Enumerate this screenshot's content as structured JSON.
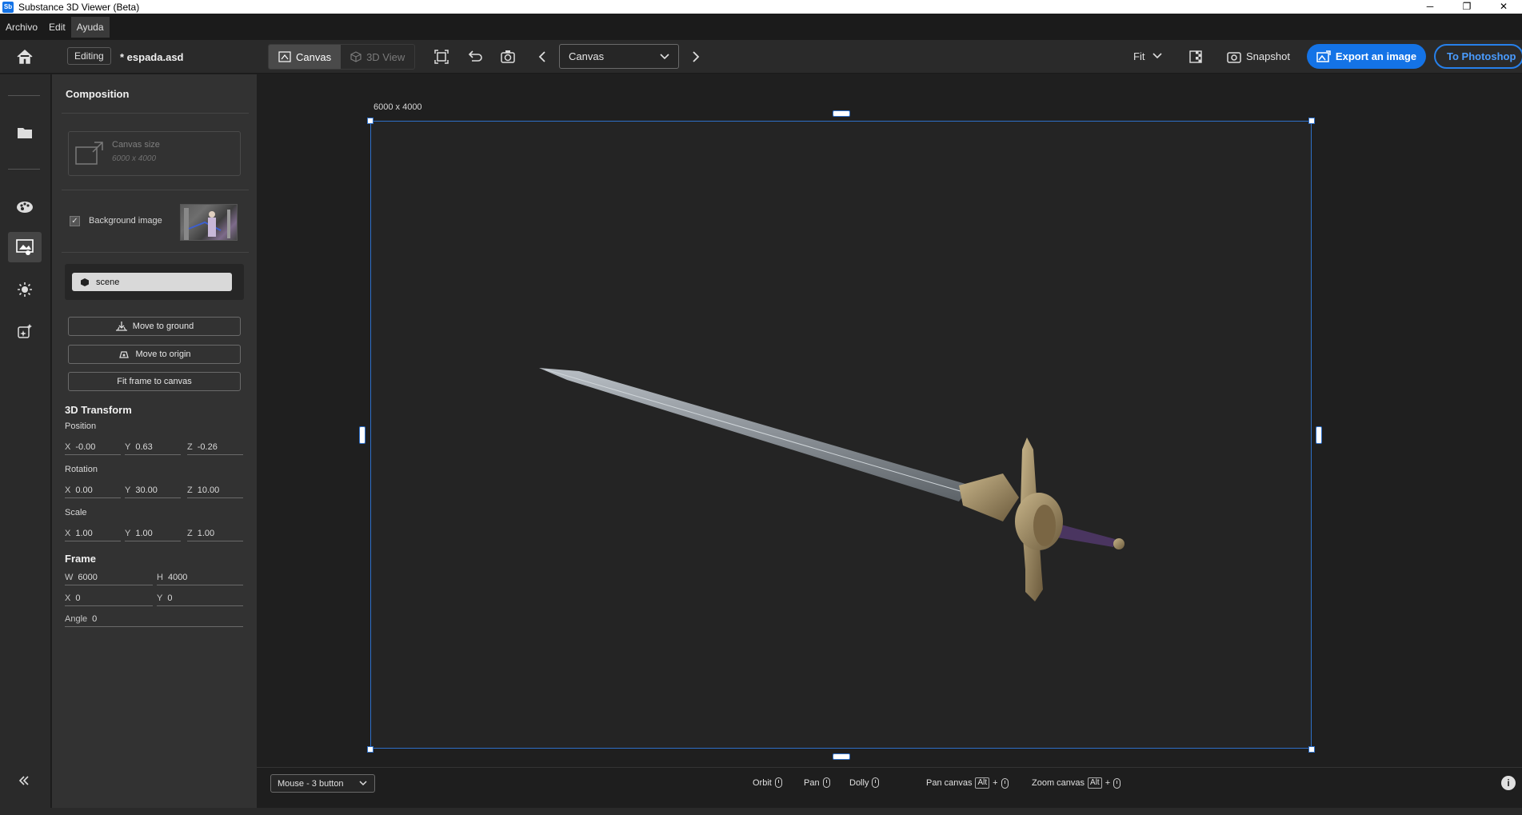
{
  "window": {
    "app_badge": "Sb",
    "title": "Substance 3D Viewer (Beta)",
    "min": "─",
    "max": "❐",
    "close": "✕"
  },
  "menu": {
    "items": [
      "Archivo",
      "Edit",
      "Ayuda"
    ]
  },
  "toolbar": {
    "editing_label": "Editing",
    "file_name": "* espada.asd",
    "canvas_tab": "Canvas",
    "view3d_tab": "3D View",
    "camera_select": "Canvas",
    "fit_label": "Fit",
    "snapshot_label": "Snapshot",
    "export_label": "Export an image",
    "photoshop_label": "To Photoshop"
  },
  "panel": {
    "title": "Composition",
    "canvas_size_label": "Canvas size",
    "canvas_size_value": "6000 x 4000",
    "background_image_label": "Background image",
    "background_image_checked": true,
    "scene_label": "scene",
    "move_to_ground": "Move to ground",
    "move_to_origin": "Move to origin",
    "fit_frame": "Fit frame to canvas",
    "transform_title": "3D Transform",
    "position_label": "Position",
    "position": {
      "x": "-0.00",
      "y": "0.63",
      "z": "-0.26"
    },
    "rotation_label": "Rotation",
    "rotation": {
      "x": "0.00",
      "y": "30.00",
      "z": "10.00"
    },
    "scale_label": "Scale",
    "scale": {
      "x": "1.00",
      "y": "1.00",
      "z": "1.00"
    },
    "frame_title": "Frame",
    "frame": {
      "w": "6000",
      "h": "4000",
      "x": "0",
      "y": "0",
      "angle": "0"
    },
    "axis_x": "X",
    "axis_y": "Y",
    "axis_z": "Z",
    "key_w": "W",
    "key_h": "H",
    "key_angle": "Angle"
  },
  "viewport": {
    "dimension_label": "6000 x 4000"
  },
  "bottombar": {
    "mouse_mode": "Mouse - 3 button",
    "orbit": "Orbit",
    "pan": "Pan",
    "dolly": "Dolly",
    "pan_canvas": "Pan canvas",
    "zoom_canvas": "Zoom canvas",
    "alt_key": "Alt",
    "plus": "+",
    "info": "i"
  },
  "colors": {
    "accent": "#1473e6",
    "frame_border": "#2e6fc8",
    "background": "#1e1e1e"
  }
}
